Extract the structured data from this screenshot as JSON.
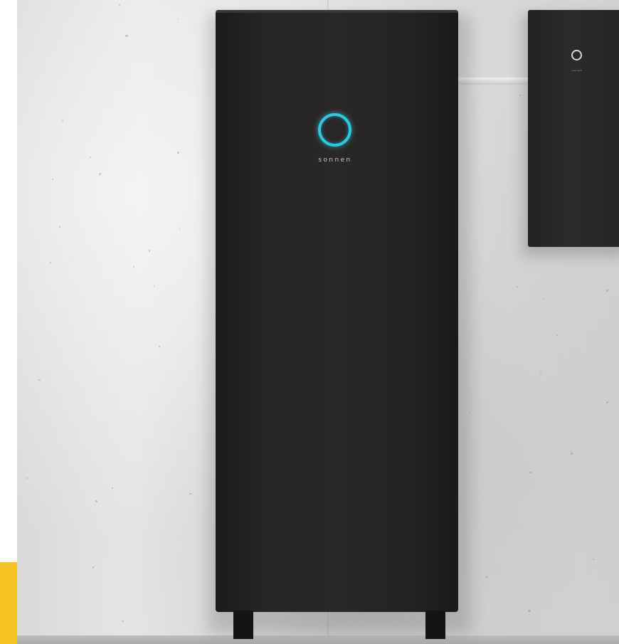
{
  "photo": {
    "brand_label": "sonnen",
    "inverter_label": "sonnen",
    "colors": {
      "ring_glow": "#2ec7e0",
      "cabinet": "#272424",
      "wall": "#e0e0df",
      "accent_block": "#f7c325"
    }
  }
}
